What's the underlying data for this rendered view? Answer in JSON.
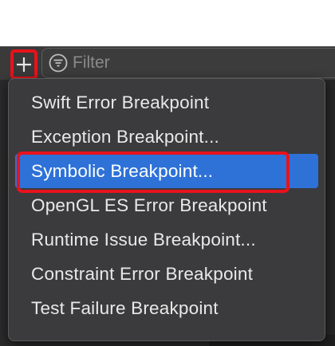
{
  "toolbar": {
    "add_button_icon": "plus-icon",
    "filter": {
      "icon": "filter-icon",
      "placeholder": "Filter"
    }
  },
  "menu": {
    "items": [
      {
        "label": "Swift Error Breakpoint",
        "selected": false
      },
      {
        "label": "Exception Breakpoint...",
        "selected": false
      },
      {
        "label": "Symbolic Breakpoint...",
        "selected": true
      },
      {
        "label": "OpenGL ES Error Breakpoint",
        "selected": false
      },
      {
        "label": "Runtime Issue Breakpoint...",
        "selected": false
      },
      {
        "label": "Constraint Error Breakpoint",
        "selected": false
      },
      {
        "label": "Test Failure Breakpoint",
        "selected": false
      }
    ]
  },
  "colors": {
    "selection": "#2e72d8",
    "annotation_red": "#e8121c",
    "menu_background": "#3b3b3d",
    "menu_text": "#e9e9e9"
  }
}
